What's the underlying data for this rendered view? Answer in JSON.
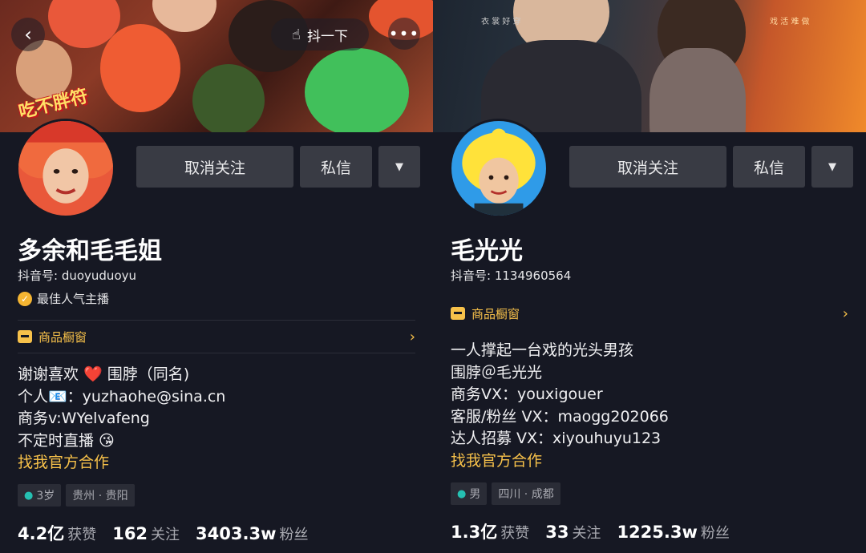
{
  "profiles": [
    {
      "cover_sticker": "吃不胖符",
      "shake_label": "抖一下",
      "buttons": {
        "unfollow": "取消关注",
        "message": "私信",
        "dropdown": "▼"
      },
      "name": "多余和毛毛姐",
      "douyin_id": "抖音号: duoyuduoyu",
      "badge": "最佳人气主播",
      "shop_label": "商品橱窗",
      "bio_lines": [
        "谢谢喜欢 ❤️ 围脖（同名)",
        "个人📧：yuzhaohe@sina.cn",
        "商务v:WYelvafeng",
        "不定时直播 😘"
      ],
      "cooperate": "找我官方合作",
      "tags": [
        "3岁",
        "贵州 · 贵阳"
      ],
      "stats": [
        {
          "num": "4.2亿",
          "label": "获赞"
        },
        {
          "num": "162",
          "label": "关注"
        },
        {
          "num": "3403.3w",
          "label": "粉丝"
        }
      ]
    },
    {
      "cover_text_left": "衣 裳 好 穿",
      "cover_text_right": "戏 活 难 做",
      "shake_label": "抖一下",
      "buttons": {
        "unfollow": "取消关注",
        "message": "私信",
        "dropdown": "▼"
      },
      "name": "毛光光",
      "douyin_id": "抖音号: 1134960564",
      "shop_label": "商品橱窗",
      "bio_lines": [
        "一人撑起一台戏的光头男孩",
        "围脖＠毛光光",
        "商务VX：youxigouer",
        "客服/粉丝 VX：maogg202066",
        "达人招募 VX：xiyouhuyu123"
      ],
      "cooperate": "找我官方合作",
      "tags": [
        "男",
        "四川 · 成都"
      ],
      "stats": [
        {
          "num": "1.3亿",
          "label": "获赞"
        },
        {
          "num": "33",
          "label": "关注"
        },
        {
          "num": "1225.3w",
          "label": "粉丝"
        }
      ]
    }
  ],
  "colors": {
    "background": "#161823",
    "accent": "#f7c14a",
    "button": "#393b44",
    "tag": "#2a2c36"
  },
  "icons": [
    "back-icon",
    "shake-hand-icon",
    "more-icon",
    "shop-icon",
    "chevron-right-icon",
    "person-icon",
    "verified-badge-icon"
  ]
}
